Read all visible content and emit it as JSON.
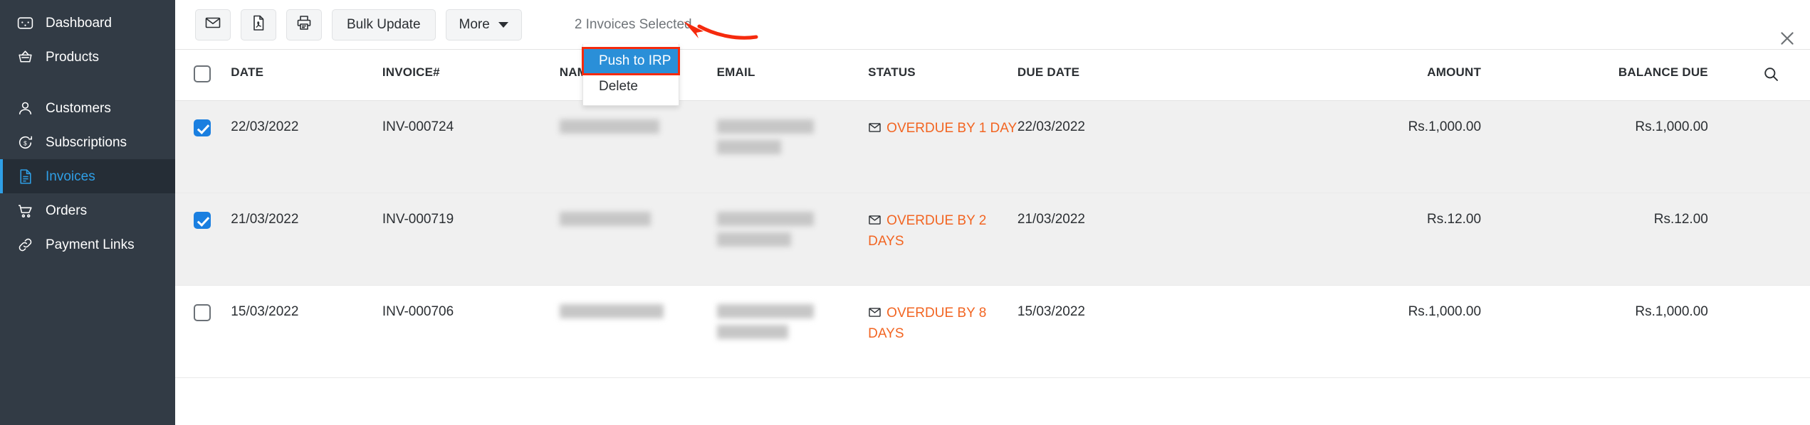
{
  "sidebar": {
    "items": [
      {
        "label": "Dashboard",
        "icon": "dashboard-icon",
        "active": false
      },
      {
        "label": "Products",
        "icon": "basket-icon",
        "active": false
      },
      {
        "label": "Customers",
        "icon": "user-icon",
        "active": false
      },
      {
        "label": "Subscriptions",
        "icon": "recurring-icon",
        "active": false
      },
      {
        "label": "Invoices",
        "icon": "document-icon",
        "active": true
      },
      {
        "label": "Orders",
        "icon": "cart-icon",
        "active": false
      },
      {
        "label": "Payment Links",
        "icon": "link-icon",
        "active": false
      }
    ],
    "bg_color": "#323b45",
    "active_color": "#2f9fe6"
  },
  "toolbar": {
    "email_button": "",
    "pdf_button": "",
    "print_button": "",
    "bulk_update_label": "Bulk Update",
    "more_label": "More",
    "selection_text": "2 Invoices Selected",
    "close_label": ""
  },
  "dropdown": {
    "items": [
      {
        "label": "Push to IRP",
        "selected": true
      },
      {
        "label": "Delete",
        "selected": false
      }
    ],
    "highlight_color": "#2a8fd8",
    "annotation_color": "#f52a0d"
  },
  "table": {
    "headers": [
      "",
      "DATE",
      "INVOICE#",
      "NAME",
      "EMAIL",
      "STATUS",
      "DUE DATE",
      "AMOUNT",
      "BALANCE DUE",
      ""
    ],
    "rows": [
      {
        "checked": true,
        "date": "22/03/2022",
        "invoice": "INV-000724",
        "name": "",
        "email": "",
        "status": "OVERDUE BY 1 DAY",
        "due_date": "22/03/2022",
        "amount": "Rs.1,000.00",
        "balance_due": "Rs.1,000.00"
      },
      {
        "checked": true,
        "date": "21/03/2022",
        "invoice": "INV-000719",
        "name": "",
        "email": "",
        "status": "OVERDUE BY 2 DAYS",
        "due_date": "21/03/2022",
        "amount": "Rs.12.00",
        "balance_due": "Rs.12.00"
      },
      {
        "checked": false,
        "date": "15/03/2022",
        "invoice": "INV-000706",
        "name": "",
        "email": "",
        "status": "OVERDUE BY 8 DAYS",
        "due_date": "15/03/2022",
        "amount": "Rs.1,000.00",
        "balance_due": "Rs.1,000.00"
      }
    ],
    "status_color": "#f26522",
    "selected_row_bg": "#f0f0f0"
  }
}
